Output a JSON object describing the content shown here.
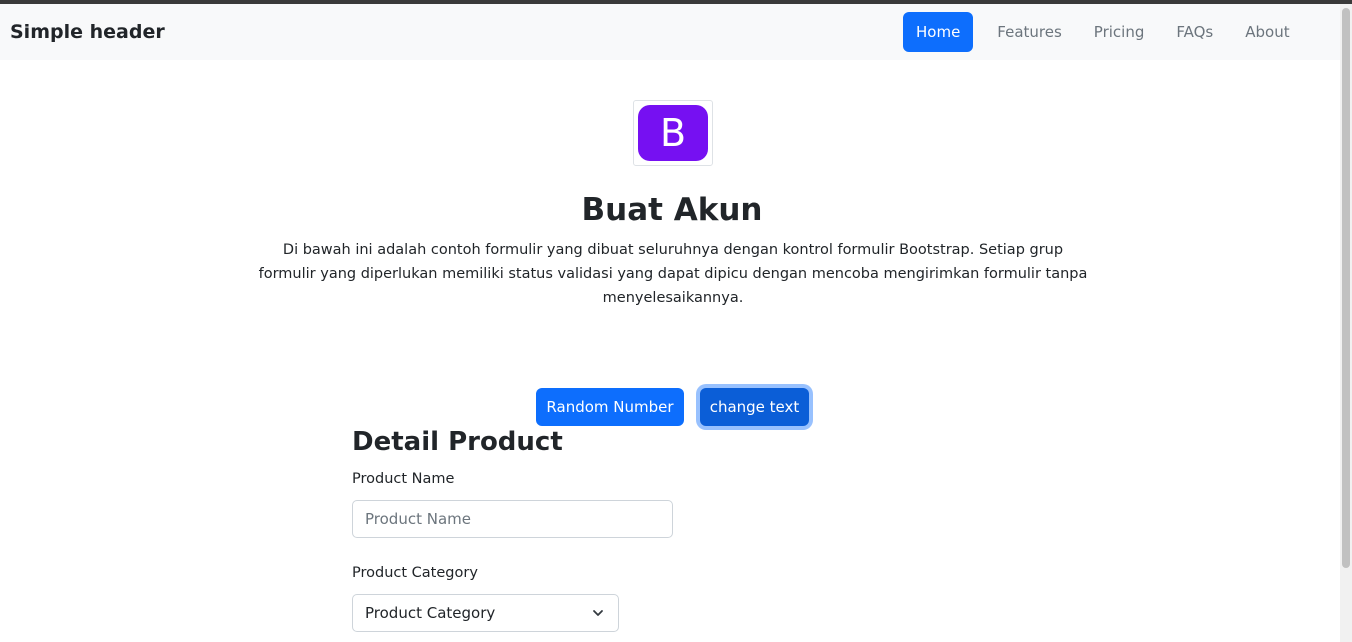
{
  "navbar": {
    "brand": "Simple header",
    "links": [
      {
        "label": "Home",
        "active": true
      },
      {
        "label": "Features"
      },
      {
        "label": "Pricing"
      },
      {
        "label": "FAQs"
      },
      {
        "label": "About"
      }
    ]
  },
  "hero": {
    "logo_letter": "B",
    "title": "Buat Akun",
    "description": "Di bawah ini adalah contoh formulir yang dibuat seluruhnya dengan kontrol formulir Bootstrap. Setiap grup formulir yang diperlukan memiliki status validasi yang dapat dipicu dengan mencoba mengirimkan formulir tanpa menyelesaikannya."
  },
  "actions": {
    "random_label": "Random Number",
    "change_label": "change text"
  },
  "form": {
    "section_title": "Detail Product",
    "product_name_label": "Product Name",
    "product_name_placeholder": "Product Name",
    "product_category_label": "Product Category",
    "product_category_selected": "Product Category"
  },
  "colors": {
    "primary": "#0d6efd",
    "logo": "#7610f2"
  }
}
